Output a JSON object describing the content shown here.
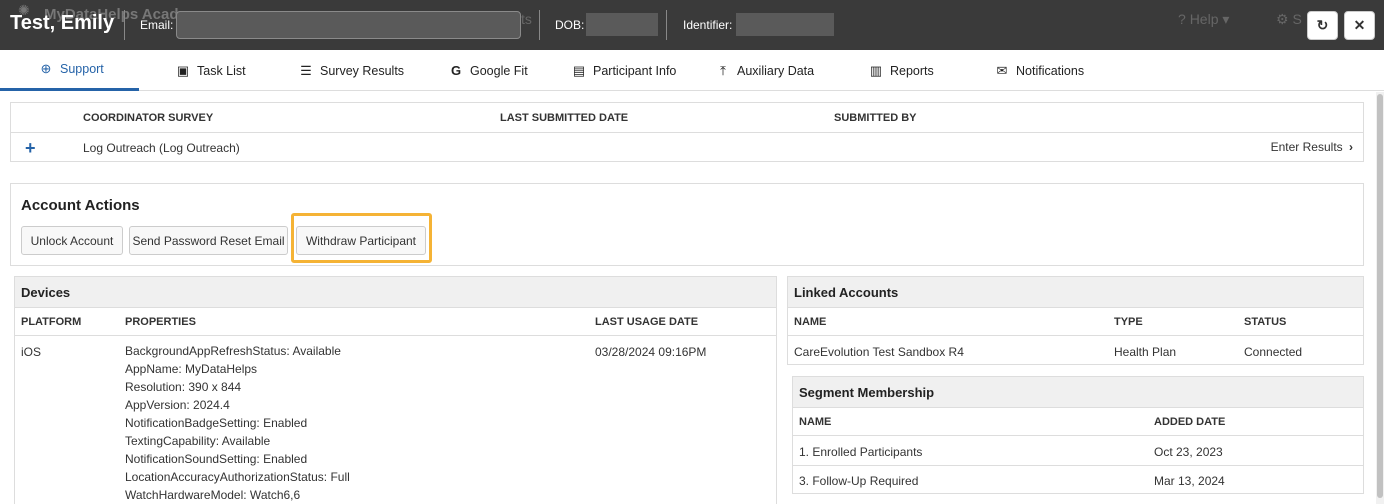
{
  "header": {
    "app_name_faded": "MyDataHelps Acad",
    "participant_name": "Test, Emily",
    "email_label": "Email:",
    "dob_label": "DOB:",
    "identifier_label": "Identifier:",
    "faded_right": "ts",
    "help_label": "Help",
    "settings_label": "S"
  },
  "tabs": [
    {
      "label": "Support"
    },
    {
      "label": "Task List"
    },
    {
      "label": "Survey Results"
    },
    {
      "label": "Google Fit"
    },
    {
      "label": "Participant Info"
    },
    {
      "label": "Auxiliary Data"
    },
    {
      "label": "Reports"
    },
    {
      "label": "Notifications"
    }
  ],
  "survey_table": {
    "headers": [
      "COORDINATOR SURVEY",
      "LAST SUBMITTED DATE",
      "SUBMITTED BY"
    ],
    "row": {
      "name": "Log Outreach (Log Outreach)",
      "action": "Enter Results"
    }
  },
  "account_actions": {
    "title": "Account Actions",
    "buttons": [
      "Unlock Account",
      "Send Password Reset Email",
      "Withdraw Participant"
    ]
  },
  "devices": {
    "title": "Devices",
    "headers": [
      "PLATFORM",
      "PROPERTIES",
      "LAST USAGE DATE"
    ],
    "rows": [
      {
        "platform": "iOS",
        "properties": [
          "BackgroundAppRefreshStatus: Available",
          "AppName: MyDataHelps",
          "Resolution: 390 x 844",
          "AppVersion: 2024.4",
          "NotificationBadgeSetting: Enabled",
          "TextingCapability: Available",
          "NotificationSoundSetting: Enabled",
          "LocationAccuracyAuthorizationStatus: Full",
          "WatchHardwareModel: Watch6,6"
        ],
        "last_usage": "03/28/2024 09:16PM"
      }
    ]
  },
  "linked_accounts": {
    "title": "Linked Accounts",
    "headers": [
      "NAME",
      "TYPE",
      "STATUS"
    ],
    "rows": [
      {
        "name": "CareEvolution Test Sandbox R4",
        "type": "Health Plan",
        "status": "Connected"
      }
    ]
  },
  "segments": {
    "title": "Segment Membership",
    "headers": [
      "NAME",
      "ADDED DATE"
    ],
    "rows": [
      {
        "name": "1. Enrolled Participants",
        "date": "Oct 23, 2023"
      },
      {
        "name": "3. Follow-Up Required",
        "date": "Mar 13, 2024"
      }
    ]
  },
  "colors": {
    "accent": "#2563a8",
    "header_bg": "#3a3a3a",
    "highlight": "#f5b335"
  }
}
